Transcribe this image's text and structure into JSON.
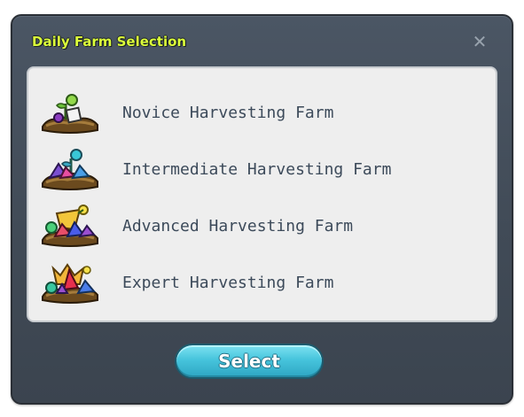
{
  "dialog": {
    "title": "Daily Farm Selection",
    "close_icon": "close-icon",
    "title_color": "#dcff3a"
  },
  "farms": [
    {
      "label": "Novice Harvesting Farm",
      "icon": "novice-farm-icon"
    },
    {
      "label": "Intermediate Harvesting Farm",
      "icon": "intermediate-farm-icon"
    },
    {
      "label": "Advanced Harvesting Farm",
      "icon": "advanced-farm-icon"
    },
    {
      "label": "Expert Harvesting Farm",
      "icon": "expert-farm-icon"
    }
  ],
  "actions": {
    "select_label": "Select",
    "select_color": "#46c4dc"
  }
}
